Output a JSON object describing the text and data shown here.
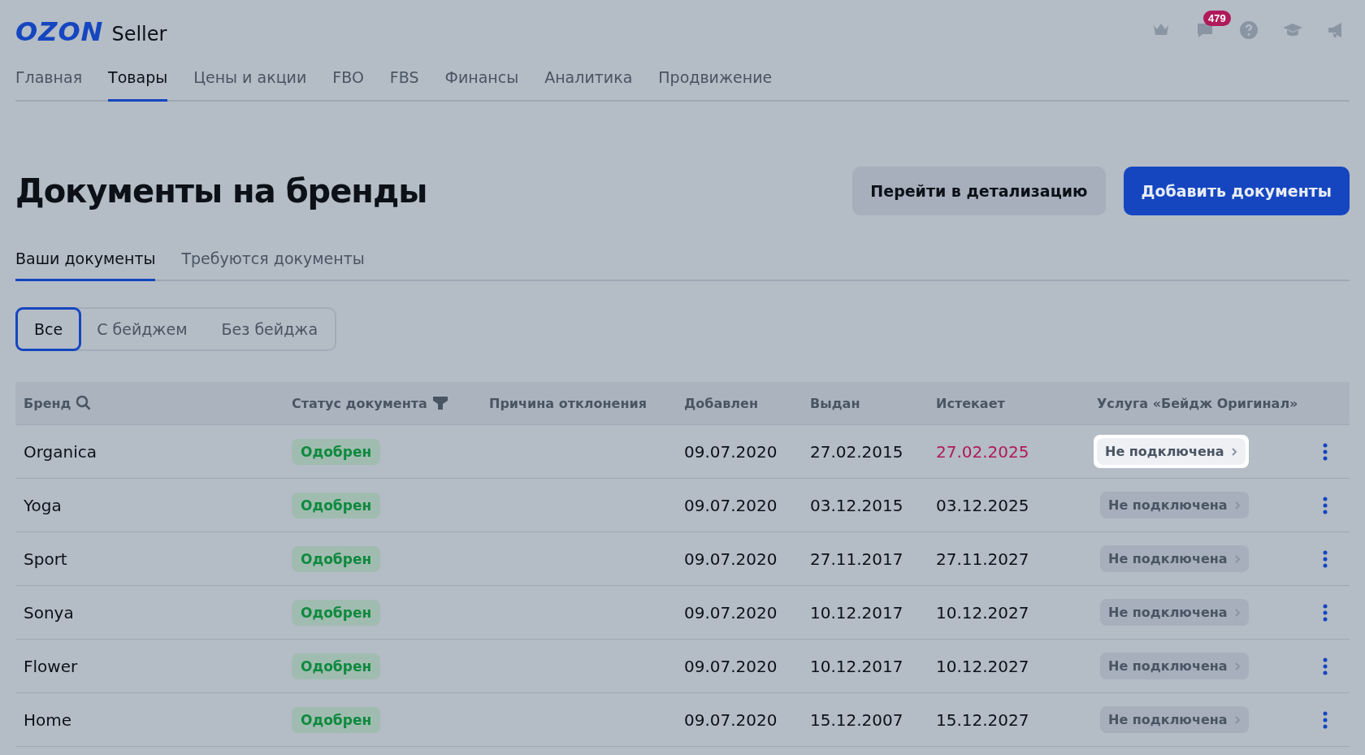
{
  "header": {
    "logo": "OZON",
    "logo_suffix": "Seller",
    "chat_badge": "479"
  },
  "nav": [
    {
      "label": "Главная",
      "selected": false
    },
    {
      "label": "Товары",
      "selected": true
    },
    {
      "label": "Цены и акции",
      "selected": false
    },
    {
      "label": "FBO",
      "selected": false
    },
    {
      "label": "FBS",
      "selected": false
    },
    {
      "label": "Финансы",
      "selected": false
    },
    {
      "label": "Аналитика",
      "selected": false
    },
    {
      "label": "Продвижение",
      "selected": false
    }
  ],
  "page_title": "Документы на бренды",
  "actions": [
    {
      "label": "Перейти в детализацию",
      "kind": "secondary"
    },
    {
      "label": "Добавить документы",
      "kind": "primary"
    }
  ],
  "tabs": [
    {
      "label": "Ваши документы",
      "selected": true
    },
    {
      "label": "Требуются документы",
      "selected": false
    }
  ],
  "filters": [
    {
      "label": "Все",
      "selected": true
    },
    {
      "label": "С бейджем",
      "selected": false
    },
    {
      "label": "Без бейджа",
      "selected": false
    }
  ],
  "table": {
    "columns": [
      {
        "label": "Бренд"
      },
      {
        "label": "Статус документа"
      },
      {
        "label": "Причина отклонения"
      },
      {
        "label": "Добавлен"
      },
      {
        "label": "Выдан"
      },
      {
        "label": "Истекает"
      },
      {
        "label": "Услуга «Бейдж Оригинал»"
      }
    ],
    "rows": [
      {
        "brand": "Organica",
        "status": "Одобрен",
        "added": "09.07.2020",
        "issued": "27.02.2015",
        "expires": "27.02.2025",
        "expiring": true,
        "service": "Не подключена",
        "highlighted": true
      },
      {
        "brand": "Yoga",
        "status": "Одобрен",
        "added": "09.07.2020",
        "issued": "03.12.2015",
        "expires": "03.12.2025",
        "expiring": false,
        "service": "Не подключена",
        "highlighted": false
      },
      {
        "brand": "Sport",
        "status": "Одобрен",
        "added": "09.07.2020",
        "issued": "27.11.2017",
        "expires": "27.11.2027",
        "expiring": false,
        "service": "Не подключена",
        "highlighted": false
      },
      {
        "brand": "Sonya",
        "status": "Одобрен",
        "added": "09.07.2020",
        "issued": "10.12.2017",
        "expires": "10.12.2027",
        "expiring": false,
        "service": "Не подключена",
        "highlighted": false
      },
      {
        "brand": "Flower",
        "status": "Одобрен",
        "added": "09.07.2020",
        "issued": "10.12.2017",
        "expires": "10.12.2027",
        "expiring": false,
        "service": "Не подключена",
        "highlighted": false
      },
      {
        "brand": "Home",
        "status": "Одобрен",
        "added": "09.07.2020",
        "issued": "15.12.2007",
        "expires": "15.12.2027",
        "expiring": false,
        "service": "Не подключена",
        "highlighted": false
      }
    ]
  }
}
